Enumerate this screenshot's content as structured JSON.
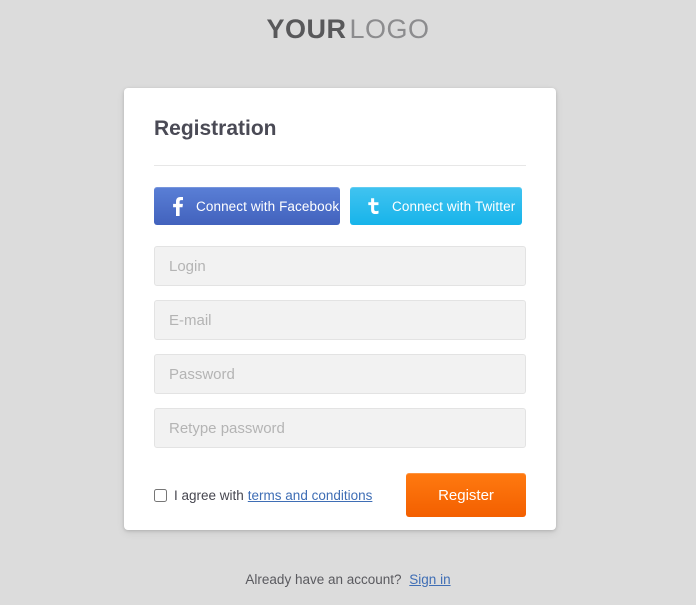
{
  "logo": {
    "bold_part": "YOUR",
    "light_part": "LOGO"
  },
  "card": {
    "title": "Registration",
    "social": {
      "facebook": {
        "label": "Connect with Facebook",
        "icon": "facebook-f-icon",
        "color": "#4262bd"
      },
      "twitter": {
        "label": "Connect with Twitter",
        "icon": "twitter-bird-icon",
        "color": "#17b4ea"
      }
    },
    "fields": [
      {
        "name": "login",
        "placeholder": "Login",
        "value": "",
        "type": "text"
      },
      {
        "name": "email",
        "placeholder": "E-mail",
        "value": "",
        "type": "text"
      },
      {
        "name": "password",
        "placeholder": "Password",
        "value": "",
        "type": "password"
      },
      {
        "name": "retype-password",
        "placeholder": "Retype password",
        "value": "",
        "type": "password"
      }
    ],
    "agreement": {
      "checked": false,
      "text": "I agree with",
      "link_text": "terms and conditions"
    },
    "submit": {
      "label": "Register",
      "color": "#f35f00"
    }
  },
  "footer": {
    "text": "Already have an account?",
    "link_text": "Sign in",
    "link_color": "#3f6eb5"
  }
}
